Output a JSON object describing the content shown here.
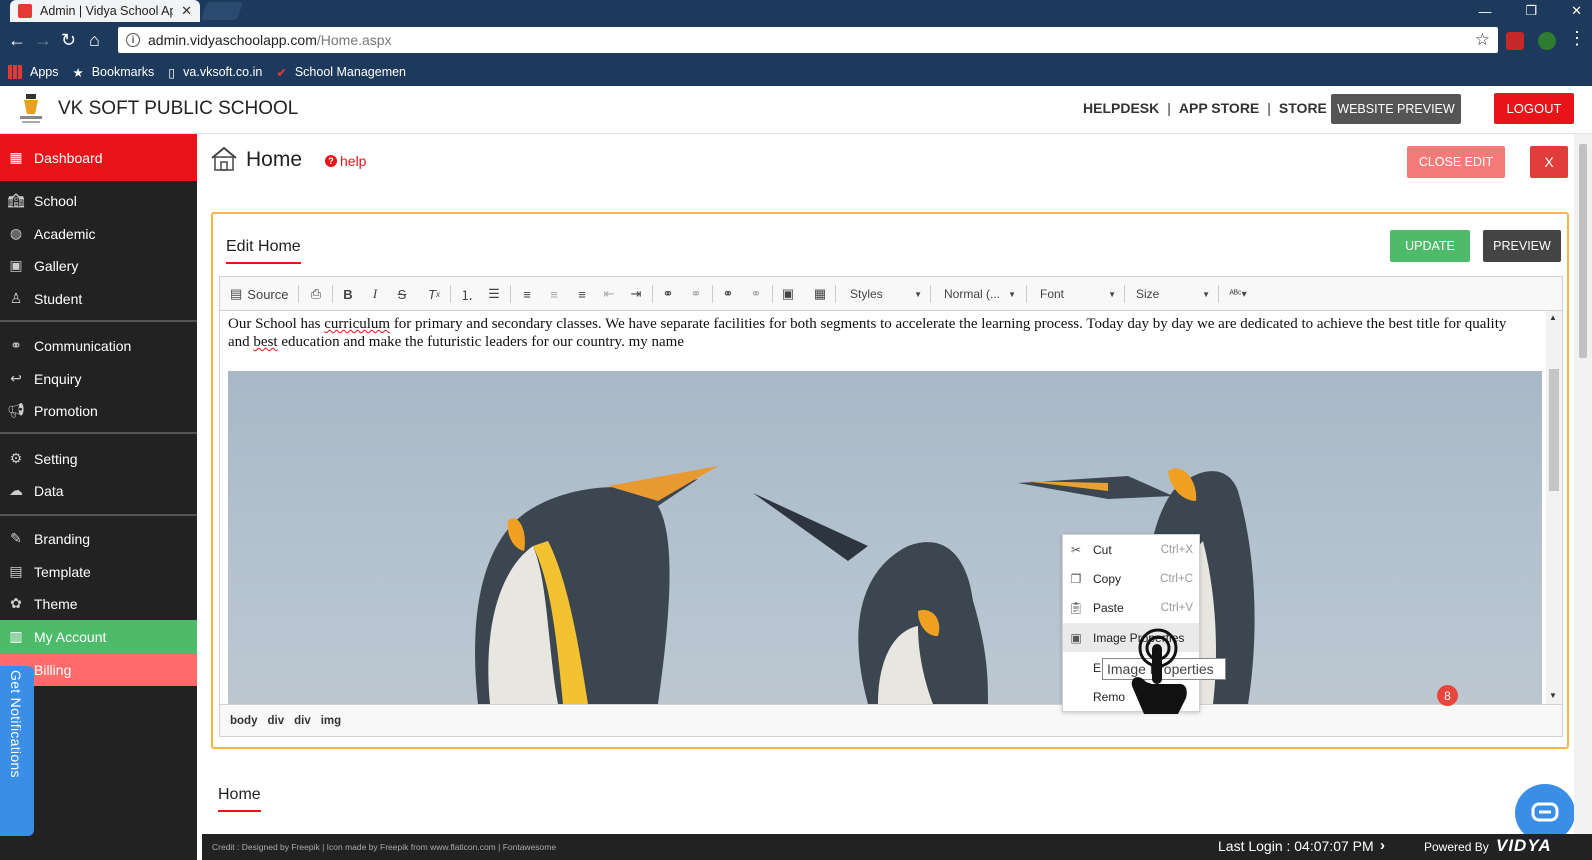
{
  "browser": {
    "tab_title": "Admin | Vidya School Ap",
    "url_host": "admin.vidyaschoolapp.com",
    "url_path": "/Home.aspx",
    "bookmarks": [
      "Apps",
      "Bookmarks",
      "va.vksoft.co.in",
      "School Managemen"
    ]
  },
  "header": {
    "school_name": "VK SOFT PUBLIC SCHOOL",
    "links": [
      "HELPDESK",
      "APP STORE",
      "STORE"
    ],
    "website_preview": "WEBSITE PREVIEW",
    "logout": "LOGOUT"
  },
  "sidebar": {
    "items": [
      {
        "label": "Dashboard",
        "icon": "dashboard-icon"
      },
      {
        "label": "School",
        "icon": "school-icon"
      },
      {
        "label": "Academic",
        "icon": "globe-icon"
      },
      {
        "label": "Gallery",
        "icon": "image-icon"
      },
      {
        "label": "Student",
        "icon": "student-icon"
      },
      {
        "label": "Communication",
        "icon": "link-icon"
      },
      {
        "label": "Enquiry",
        "icon": "reply-icon"
      },
      {
        "label": "Promotion",
        "icon": "megaphone-icon"
      },
      {
        "label": "Setting",
        "icon": "gear-icon"
      },
      {
        "label": "Data",
        "icon": "cloud-icon"
      },
      {
        "label": "Branding",
        "icon": "brush-icon"
      },
      {
        "label": "Template",
        "icon": "template-icon"
      },
      {
        "label": "Theme",
        "icon": "palette-icon"
      },
      {
        "label": "My Account",
        "icon": "account-icon"
      },
      {
        "label": "Billing",
        "icon": "billing-icon"
      }
    ],
    "notifications_tab": "Get Notifications"
  },
  "page": {
    "title": "Home",
    "help": "help",
    "close_edit": "CLOSE EDIT",
    "close_x": "X"
  },
  "editor": {
    "heading": "Edit Home",
    "update": "UPDATE",
    "preview": "PREVIEW",
    "toolbar": {
      "source": "Source",
      "styles": "Styles",
      "format": "Normal (...",
      "font": "Font",
      "size": "Size"
    },
    "text_parts": [
      "Our School has ",
      "curriculum",
      " for primary and secondary classes. We have separate facilities for both segments to accelerate the learning process. Today day by day we are dedicated to achieve the best title for quality and ",
      "best",
      " education and make the futuristic leaders for our country. my name"
    ],
    "path": [
      "body",
      "div",
      "div",
      "img"
    ]
  },
  "context_menu": {
    "items": [
      {
        "label": "Cut",
        "key": "Ctrl+X",
        "icon": "scissors-icon"
      },
      {
        "label": "Copy",
        "key": "Ctrl+C",
        "icon": "copy-icon"
      },
      {
        "label": "Paste",
        "key": "Ctrl+V",
        "icon": "paste-icon"
      },
      {
        "label": "Image Properties",
        "key": "",
        "icon": "image-icon"
      },
      {
        "label": "E",
        "key": "",
        "icon": ""
      },
      {
        "label": "Remo",
        "key": "",
        "icon": ""
      }
    ],
    "tooltip": "Image Properties"
  },
  "badge_count": "8",
  "section_home": "Home",
  "footer": {
    "credit": "Credit : Designed by Freepik | Icon made by Freepik from www.flaticon.com | Fontawesome",
    "last_login": "Last Login : 04:07:07 PM",
    "powered_by": "Powered By",
    "brand": "VIDYA"
  },
  "colors": {
    "accent_red": "#e8141a",
    "green": "#4dbb6a",
    "orange_border": "#f5b547",
    "chrome_blue": "#1d3a5c"
  }
}
